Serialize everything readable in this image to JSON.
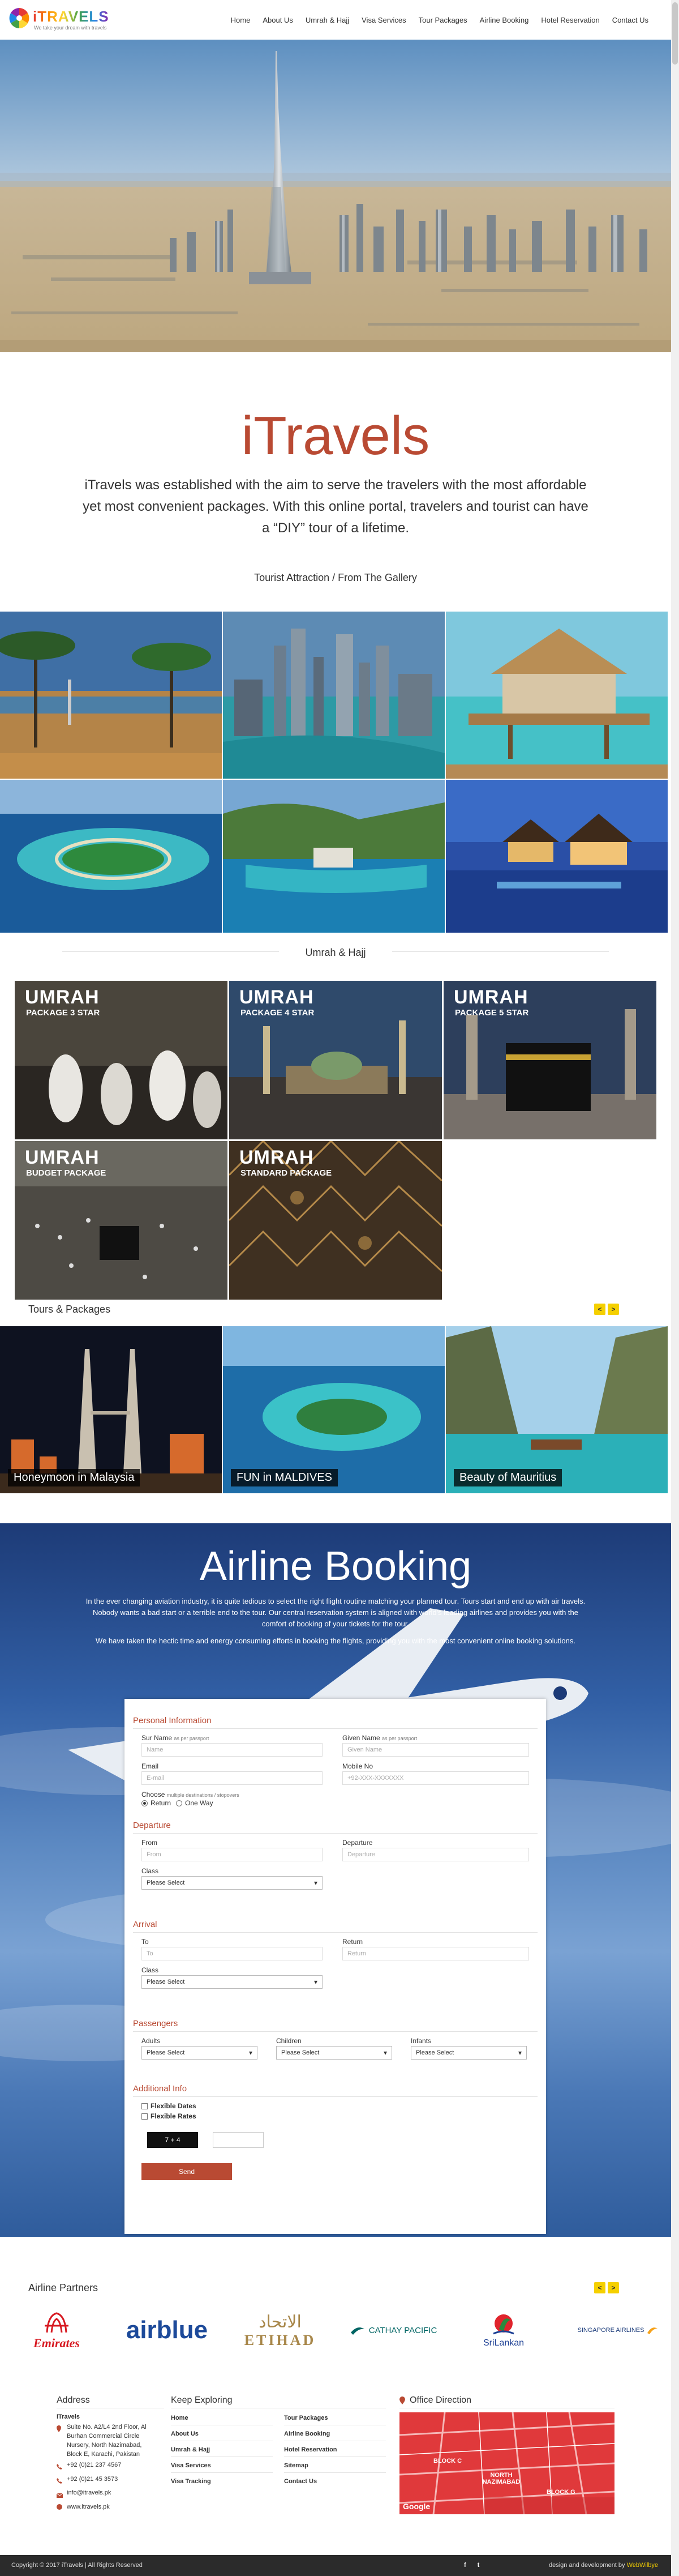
{
  "header": {
    "logo_text": "iTRAVELS",
    "logo_tagline": "We take your dream with travels",
    "nav": [
      "Home",
      "About Us",
      "Umrah & Hajj",
      "Visa Services",
      "Tour Packages",
      "Airline Booking",
      "Hotel Reservation",
      "Contact Us"
    ]
  },
  "intro": {
    "title": "iTravels",
    "text": "iTravels was established with the aim to serve the travelers with the most affordable yet most convenient packages. With this online portal, travelers and tourist can have a “DIY” tour of a lifetime."
  },
  "gallery": {
    "heading": "Tourist Attraction / From The Gallery"
  },
  "umrah": {
    "heading": "Umrah & Hajj",
    "packages": [
      {
        "title": "UMRAH",
        "subtitle": "PACKAGE 3 STAR"
      },
      {
        "title": "UMRAH",
        "subtitle": "PACKAGE 4 STAR"
      },
      {
        "title": "UMRAH",
        "subtitle": "PACKAGE 5 STAR"
      },
      {
        "title": "UMRAH",
        "subtitle": "BUDGET PACKAGE"
      },
      {
        "title": "UMRAH",
        "subtitle": "STANDARD PACKAGE"
      }
    ]
  },
  "tours": {
    "heading": "Tours & Packages",
    "prev": "<",
    "next": ">",
    "items": [
      "Honeymoon in Malaysia",
      "FUN in MALDIVES",
      "Beauty of Mauritius"
    ]
  },
  "airline": {
    "title": "Airline Booking",
    "para1": "In the ever changing aviation industry, it is quite tedious to select the right flight routine matching your planned tour. Tours start and end up with air travels. Nobody wants a bad start or a terrible end to the tour. Our central reservation system is aligned with world's leading airlines and provides you with the comfort of booking of your tickets for the tour.",
    "para2": "We have taken the hectic time and energy consuming efforts in booking the flights, providing you with the most convenient online booking solutions."
  },
  "form": {
    "personal_title": "Personal Information",
    "surname_label": "Sur Name",
    "surname_note": "as per passport",
    "surname_placeholder": "Name",
    "givenname_label": "Given Name",
    "givenname_note": "as per passport",
    "givenname_placeholder": "Given Name",
    "email_label": "Email",
    "email_placeholder": "E-mail",
    "mobile_label": "Mobile No",
    "mobile_placeholder": "+92-XXX-XXXXXXX",
    "choose_label": "Choose",
    "choose_note": "multiple destinations / stopovers",
    "trip_options": [
      "Return",
      "One Way"
    ],
    "departure_title": "Departure",
    "from_label": "From",
    "from_placeholder": "From",
    "departure_label": "Departure",
    "departure_placeholder": "Departure",
    "class_label": "Class",
    "select_placeholder": "Please Select",
    "arrival_title": "Arrival",
    "to_label": "To",
    "to_placeholder": "To",
    "return_label": "Return",
    "return_placeholder": "Return",
    "passengers_title": "Passengers",
    "adults_label": "Adults",
    "children_label": "Children",
    "infants_label": "Infants",
    "additional_title": "Additional Info",
    "flexible_dates": "Flexible Dates",
    "flexible_rates": "Flexible Rates",
    "captcha": "7 + 4",
    "send_label": "Send"
  },
  "partners": {
    "heading": "Airline Partners",
    "prev": "<",
    "next": ">",
    "logos": [
      "Emirates",
      "airblue",
      "ETIHAD",
      "CATHAY PACIFIC",
      "SriLankan",
      "SINGAPORE AIRLINES"
    ]
  },
  "footer": {
    "address_title": "Address",
    "company": "iTravels",
    "address": "Suite No. A2/L4 2nd Floor, Al Burhan Commercial Circle Nursery, North Nazimabad, Block E, Karachi, Pakistan",
    "phone1": "+92 (0)21 237 4567",
    "phone2": "+92 (0)21 45 3573",
    "email": "info@itravels.pk",
    "web": "www.itravels.pk",
    "explore_title": "Keep Exploring",
    "links_col1": [
      "Home",
      "About Us",
      "Umrah & Hajj",
      "Visa Services",
      "Visa Tracking"
    ],
    "links_col2": [
      "Tour Packages",
      "Airline Booking",
      "Hotel Reservation",
      "Sitemap",
      "Contact Us"
    ],
    "office_title": "Office Direction",
    "map_labels": [
      "BLOCK C",
      "NORTH NAZIMABAD",
      "BLOCK G"
    ],
    "map_brand": "Google",
    "copyright": "Copyright © 2017 iTravels  |  All Rights Reserved",
    "credit_prefix": "design and development by",
    "credit_brand": "WebWilbye",
    "social": [
      "f",
      "t"
    ]
  },
  "colors": {
    "accent": "#b94a33",
    "arrow_bg": "#f5d000",
    "footer_bg": "#2b2b2b"
  }
}
